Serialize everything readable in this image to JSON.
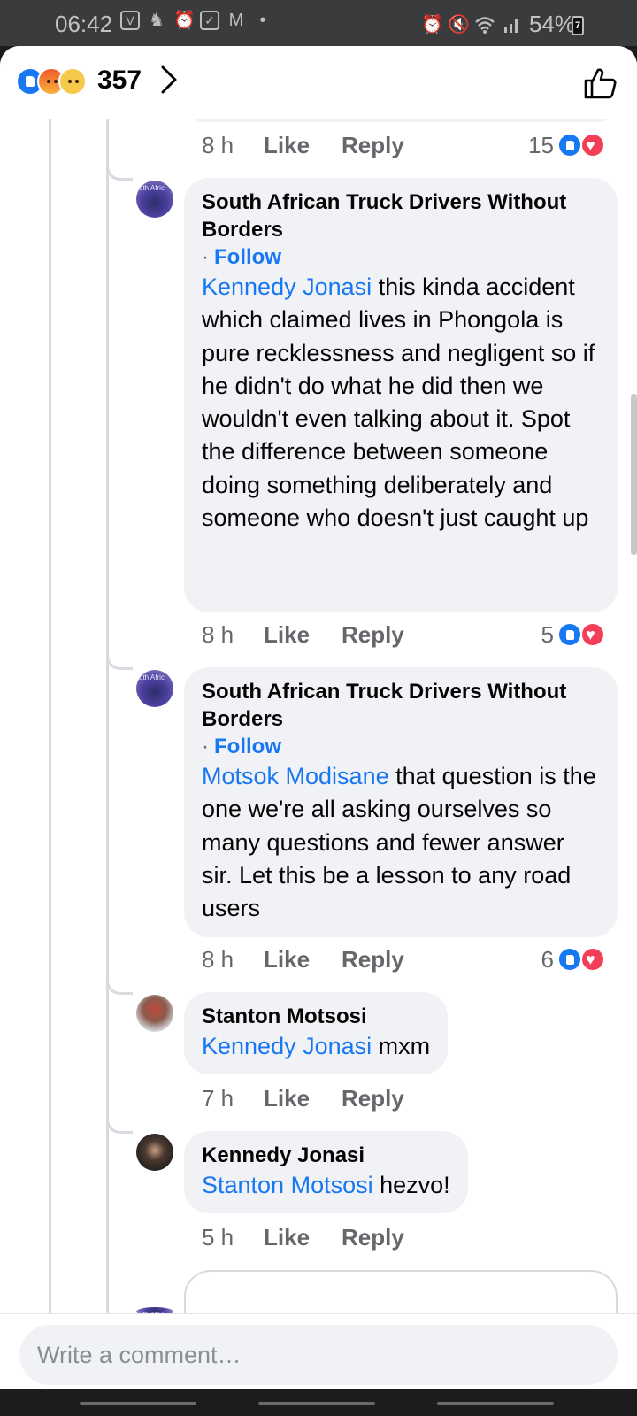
{
  "status_bar": {
    "time": "06:42",
    "left_icons": [
      "vpn-icon",
      "person-fill-icon",
      "alarm-icon",
      "checkbox-icon",
      "gmail-icon"
    ],
    "dot": "•",
    "battery": "54%",
    "battery_badge": "7"
  },
  "header": {
    "reaction_count": "357",
    "reactions": [
      "like",
      "angry",
      "sad"
    ]
  },
  "comments": [
    {
      "time": "8 h",
      "like": "Like",
      "reply": "Reply",
      "reaction_count": "15"
    },
    {
      "author": "South African Truck Drivers Without Borders",
      "follow": "Follow",
      "follow_dot": "·",
      "mention": "Kennedy Jonasi",
      "text": " this kinda accident which claimed lives in Phongola is pure recklessness and negligent so if he didn't do what he did then we wouldn't even talking about it. Spot the difference between someone doing something deliberately and someone who doesn't just caught up",
      "time": "8 h",
      "like": "Like",
      "reply": "Reply",
      "reaction_count": "5"
    },
    {
      "author": "South African Truck Drivers Without Borders",
      "follow": "Follow",
      "follow_dot": "·",
      "mention": "Motsok Modisane",
      "text": " that question is the one we're all asking ourselves so many questions and fewer answer sir. Let this be a lesson to any road users",
      "time": "8 h",
      "like": "Like",
      "reply": "Reply",
      "reaction_count": "6"
    },
    {
      "author": "Stanton Motsosi",
      "mention": "Kennedy Jonasi",
      "text": " mxm",
      "time": "7 h",
      "like": "Like",
      "reply": "Reply"
    },
    {
      "author": "Kennedy Jonasi",
      "mention": "Stanton Motsosi",
      "text": " hezvo!",
      "time": "5 h",
      "like": "Like",
      "reply": "Reply"
    }
  ],
  "composer": {
    "placeholder": "Write a comment…"
  },
  "colors": {
    "accent": "#1877f2",
    "bubble": "#f0f2f5",
    "secondary_text": "#65676b",
    "love": "#f33e58"
  }
}
